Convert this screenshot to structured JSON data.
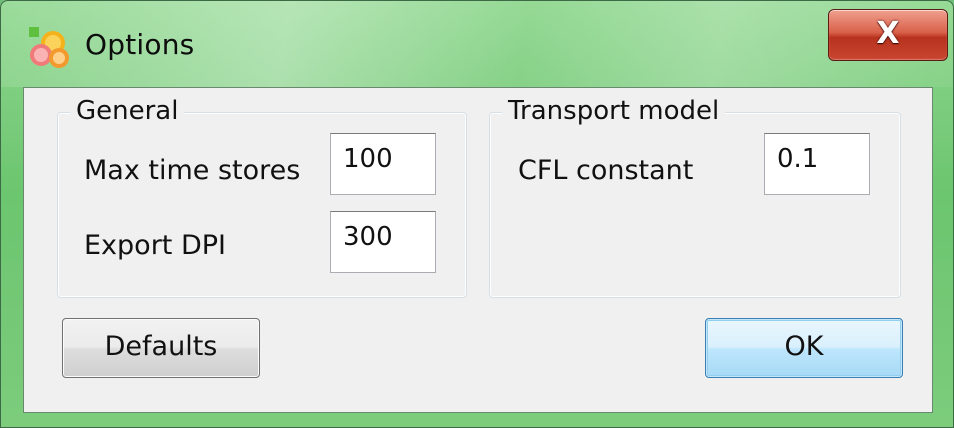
{
  "window": {
    "title": "Options",
    "close_glyph": "X"
  },
  "general": {
    "label": "General",
    "max_time_stores": {
      "label": "Max time stores",
      "value": "100"
    },
    "export_dpi": {
      "label": "Export DPI",
      "value": "300"
    }
  },
  "transport": {
    "label": "Transport model",
    "cfl_constant": {
      "label": "CFL constant",
      "value": "0.1"
    }
  },
  "buttons": {
    "defaults": "Defaults",
    "ok": "OK"
  },
  "icons": {
    "app": "citrus-slices-icon",
    "close": "close-icon"
  },
  "colors": {
    "titlebar": "#6cc56f",
    "close_button": "#c9452f",
    "client_bg": "#f0f0f0",
    "default_button": "#bee6fd"
  }
}
